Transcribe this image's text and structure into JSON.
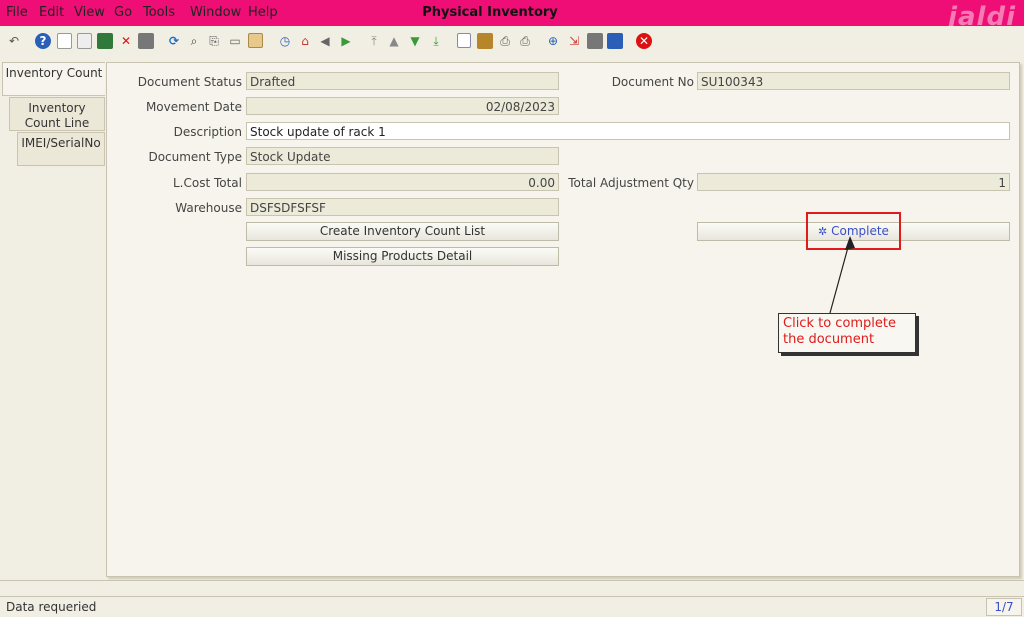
{
  "window": {
    "title": "Physical Inventory",
    "watermark": "jaldi"
  },
  "menu": [
    "File",
    "Edit",
    "View",
    "Go",
    "Tools",
    "Window",
    "Help"
  ],
  "toolbar_icons": [
    "undo-icon",
    "help-icon",
    "new-icon",
    "copy-icon",
    "save-icon",
    "delete-icon",
    "print-preview-icon",
    "refresh-icon",
    "find-icon",
    "attach-icon",
    "chat-icon",
    "grid-toggle-icon",
    "history-icon",
    "home-icon",
    "back-icon",
    "forward-icon",
    "first-icon",
    "previous-icon",
    "next-icon",
    "last-icon",
    "report-icon",
    "archive-icon",
    "print-icon",
    "print-setup-icon",
    "zoom-across-icon",
    "workflow-icon",
    "request-icon",
    "product-info-icon",
    "close-window-icon"
  ],
  "tabs": [
    "Inventory Count",
    "Inventory Count Line",
    "IMEI/SerialNo"
  ],
  "form": {
    "document_status_label": "Document Status",
    "document_status_value": "Drafted",
    "document_no_label": "Document No",
    "document_no_value": "SU100343",
    "movement_date_label": "Movement Date",
    "movement_date_value": "02/08/2023",
    "description_label": "Description",
    "description_value": "Stock update of rack 1",
    "document_type_label": "Document Type",
    "document_type_value": "Stock Update",
    "lcost_total_label": "L.Cost Total",
    "lcost_total_value": "0.00",
    "total_adjustment_qty_label": "Total Adjustment Qty",
    "total_adjustment_qty_value": "1",
    "warehouse_label": "Warehouse",
    "warehouse_value": "DSFSDFSFSF",
    "create_list_button": "Create Inventory Count List",
    "missing_products_button": "Missing Products Detail",
    "complete_button": "Complete"
  },
  "annotation": {
    "callout_text": "Click to complete the document",
    "highlight_color": "#e01b1b"
  },
  "status": {
    "message": "Data requeried",
    "record": "1/7"
  },
  "colors": {
    "menubar": "#ee0e76",
    "accent_link": "#3a4fc4"
  }
}
